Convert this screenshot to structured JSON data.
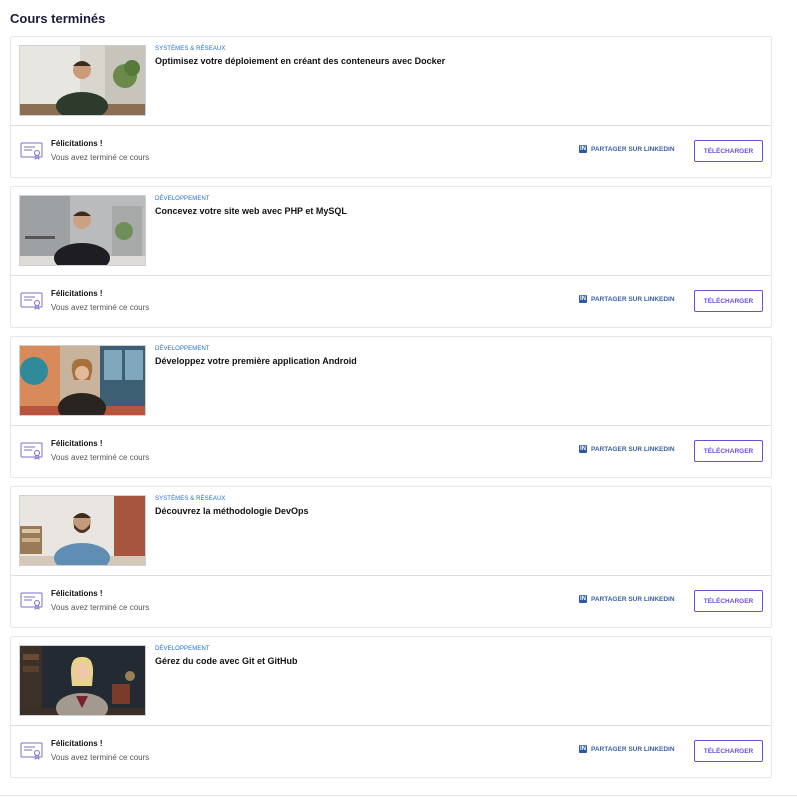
{
  "page": {
    "title": "Cours terminés"
  },
  "common": {
    "congrats": "Félicitations !",
    "completed": "Vous avez terminé ce cours",
    "linkedin": "Partager sur LinkedIn",
    "download": "Télécharger",
    "icons": {
      "certificate": "certificate-icon",
      "linkedin": "linkedin-icon"
    }
  },
  "courses": [
    {
      "category": "Systèmes & Réseaux",
      "title": "Optimisez votre déploiement en créant des conteneurs avec Docker"
    },
    {
      "category": "Développement",
      "title": "Concevez votre site web avec PHP et MySQL"
    },
    {
      "category": "Développement",
      "title": "Développez votre première application Android"
    },
    {
      "category": "Systèmes & Réseaux",
      "title": "Découvrez la méthodologie DevOps"
    },
    {
      "category": "Développement",
      "title": "Gérez du code avec Git et GitHub"
    }
  ]
}
